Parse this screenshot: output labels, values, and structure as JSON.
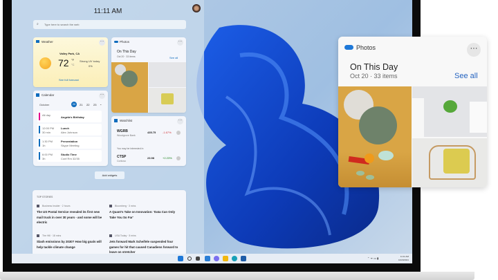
{
  "clock": "11:11 AM",
  "search": {
    "placeholder": "Type here to search the web"
  },
  "weather": {
    "title": "Weather",
    "location": "Valley Park, CA",
    "temp": "72",
    "unit_f": "°F",
    "unit_c": "°C",
    "condition": "Strong UV today",
    "precip": "0%",
    "link": "See full forecast"
  },
  "photos_small": {
    "title": "Photos",
    "heading": "On This Day",
    "sub": "Oct 20 · 33 items",
    "see_all": "See all"
  },
  "calendar": {
    "title": "Calendar",
    "month": "October",
    "days": [
      "20",
      "21",
      "22",
      "23"
    ],
    "events": [
      {
        "time": "All day",
        "dur": "",
        "name": "Angela's Birthday",
        "sub": "",
        "color": "#e3008c"
      },
      {
        "time": "12:00 PM",
        "dur": "30 min",
        "name": "Lunch",
        "sub": "Alex Johnson",
        "color": "#0f6cbd"
      },
      {
        "time": "1:30 PM",
        "dur": "1h",
        "name": "Presentation",
        "sub": "Skype Meeting",
        "color": "#0f6cbd"
      },
      {
        "time": "6:00 PM",
        "dur": "3h",
        "name": "Studio Time",
        "sub": "Conf Rm 32/35",
        "color": "#0f6cbd"
      }
    ]
  },
  "watchlist": {
    "title": "Watchlist",
    "interest": "You may be interested in",
    "stocks": [
      {
        "sym": "WGRB",
        "name": "Woodgrove Bank",
        "price": "435.75",
        "change": "-1.67%",
        "color": "#d13438"
      },
      {
        "sym": "CTSP",
        "name": "Contoso",
        "price": "23.98",
        "change": "+2.23%",
        "color": "#107c10"
      }
    ]
  },
  "add_widgets": "Add widgets",
  "stories": {
    "header": "TOP STORIES",
    "items": [
      {
        "source": "Business Insider · 2 hours",
        "headline": "The US Postal Service revealed its first new mail truck in over 30 years - and some will be electric"
      },
      {
        "source": "Bloomberg · 3 mins",
        "headline": "A Quant's Take on Innovation: 'Data Can Only Take You So Far'"
      },
      {
        "source": "The Hill · 18 mins",
        "headline": "Slash emissions by 2030? How big goals will help tackle climate change"
      },
      {
        "source": "USA Today · 5 mins",
        "headline": "Jets forward Mark Scheifele suspended four games for hit that caused Canadiens forward to leave on stretcher"
      }
    ]
  },
  "tray": {
    "time": "11:11 AM",
    "date": "10/20/2021"
  },
  "photos_big": {
    "title": "Photos",
    "heading": "On This Day",
    "sub": "Oct 20 · 33 items",
    "see_all": "See all"
  },
  "colors": {
    "accent": "#0f6cbd"
  }
}
